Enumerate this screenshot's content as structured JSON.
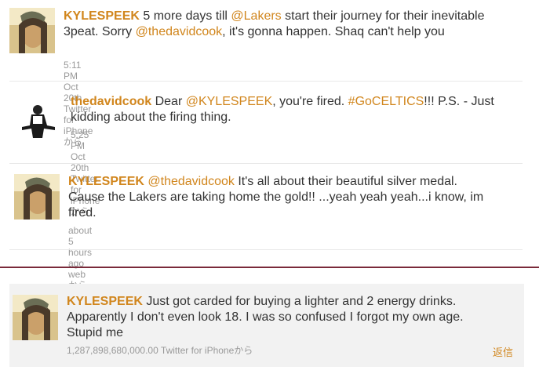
{
  "tweets": [
    {
      "username": "KYLESPEEK",
      "parts": [
        " 5 more days till ",
        "@Lakers",
        " start their journey for their inevitable 3peat. Sorry ",
        "@thedavidcook",
        ", it's gonna happen. Shaq can't help you"
      ],
      "time": "5:11 PM Oct 20th",
      "source": " Twitter for iPhone",
      "suffix": "から"
    },
    {
      "username": "thedavidcook",
      "parts": [
        " Dear ",
        "@KYLESPEEK",
        ", you're fired. ",
        "#GoCELTICS",
        "!!! P.S. - Just kidding about the firing thing."
      ],
      "time": "5:25 PM Oct 20th",
      "source": " Twitter for iPhone",
      "suffix": "から"
    },
    {
      "username": "KYLESPEEK",
      "parts": [
        " ",
        "@thedavidcook",
        " It's all about their beautiful silver medal. Cause the Lakers are taking home the gold!! ...yeah yeah yeah...i know, im fired."
      ],
      "time": "about 5 hours ago",
      "source": " web",
      "suffix": "から"
    },
    {
      "username": "KYLESPEEK",
      "parts": [
        " Just got carded for buying a lighter and 2 energy drinks. Apparently I don't even look 18. I was so confused I forgot my own age. Stupid me"
      ],
      "time": "1,287,898,680,000.00",
      "source": " Twitter for iPhone",
      "suffix": "から",
      "reply_label": "返信"
    }
  ],
  "colors": {
    "link": "#d1861d",
    "text": "#333333",
    "meta": "#999999",
    "highlight_bg": "#f2f2f2",
    "separator": "#7a2a3a"
  }
}
